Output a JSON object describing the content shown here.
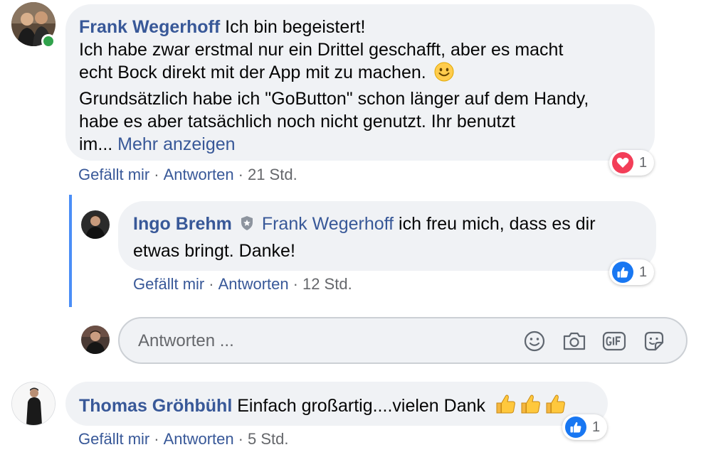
{
  "comments": [
    {
      "author": "Frank Wegerhoff",
      "lines": [
        "Ich bin begeistert!",
        "Ich habe zwar erstmal nur ein Drittel geschafft, aber es macht",
        "echt Bock direkt mit der App mit zu machen.",
        "Grundsätzlich habe ich \"GoButton\" schon länger auf dem Handy,",
        "habe es aber tatsächlich noch nicht genutzt. Ihr benutzt",
        "im..."
      ],
      "more_label": "Mehr anzeigen",
      "emoji": "smiley",
      "online": true,
      "reaction": {
        "type": "love",
        "count": "1"
      },
      "actions": {
        "like": "Gefällt mir",
        "reply": "Antworten",
        "time": "21 Std."
      }
    },
    {
      "author": "Thomas Gröhbühl",
      "text": "Einfach großartig....vielen Dank",
      "emoji": "thumbs-up x3",
      "reaction": {
        "type": "like",
        "count": "1"
      },
      "actions": {
        "like": "Gefällt mir",
        "reply": "Antworten",
        "time": "5 Std."
      }
    }
  ],
  "reply": {
    "author": "Ingo Brehm",
    "badge": "shield-icon",
    "mention": "Frank Wegerhoff",
    "lines": [
      "ich freu mich, dass es dir",
      "etwas bringt. Danke!"
    ],
    "reaction": {
      "type": "like",
      "count": "1"
    },
    "actions": {
      "like": "Gefällt mir",
      "reply": "Antworten",
      "time": "12 Std."
    }
  },
  "reply_box": {
    "placeholder": "Antworten ...",
    "tools": [
      "emoji-icon",
      "camera-icon",
      "gif-icon",
      "sticker-icon"
    ]
  },
  "colors": {
    "link": "#385898",
    "bubble": "#f0f2f5",
    "meta": "#65676b",
    "like_blue": "#1877f2",
    "love_red": "#f33e58",
    "online": "#31a24c",
    "thread_line": "#4b8ef7"
  },
  "separator": "·"
}
